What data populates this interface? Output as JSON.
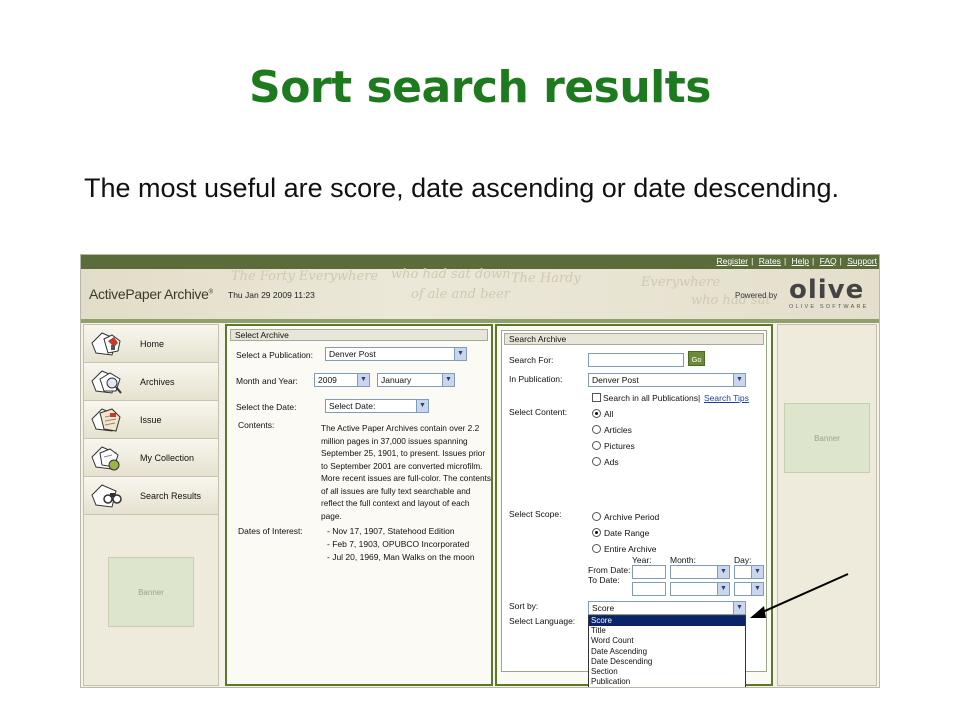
{
  "slide": {
    "title": "Sort search results",
    "body": "The most useful are score, date ascending or date descending."
  },
  "app": {
    "top_links": [
      "Register",
      "Rates",
      "Help",
      "FAQ",
      "Support"
    ],
    "brand": "ActivePaper Archive",
    "brand_mark": "®",
    "datetime": "Thu Jan 29 2009 11:23",
    "powered_by": "Powered by",
    "logo_word": "olive",
    "logo_sub": "OLIVE SOFTWARE",
    "watermark_lines": [
      "The Forty Everywhere",
      "who had sat down",
      "The Hardy",
      "of ale and beer",
      "Everywhere",
      "who had sat"
    ]
  },
  "nav": {
    "items": [
      {
        "label": "Home",
        "icon": "home-icon"
      },
      {
        "label": "Archives",
        "icon": "archives-search-icon"
      },
      {
        "label": "Issue",
        "icon": "issue-icon"
      },
      {
        "label": "My Collection",
        "icon": "collection-icon"
      },
      {
        "label": "Search Results",
        "icon": "binoculars-icon"
      }
    ],
    "banner": "Banner"
  },
  "select_archive": {
    "header": "Select Archive",
    "publication_label": "Select a Publication:",
    "publication_value": "Denver Post",
    "month_year_label": "Month and Year:",
    "year_value": "2009",
    "month_value": "January",
    "date_label": "Select the Date:",
    "date_value": "Select Date:",
    "contents_label": "Contents:",
    "contents_text": "The Active Paper Archives contain over 2.2 million pages in 37,000 issues spanning September 25, 1901, to present. Issues prior to September 2001 are converted microfilm. More recent issues are full-color. The contents of all issues are fully text searchable and reflect the full context and layout of each page.",
    "dates_label": "Dates of Interest:",
    "dates": [
      "- Nov 17, 1907, Statehood Edition",
      "- Feb 7, 1903, OPUBCO Incorporated",
      "- Jul 20, 1969, Man Walks on the moon"
    ]
  },
  "search_archive": {
    "header": "Search Archive",
    "search_for_label": "Search For:",
    "search_for_value": "",
    "go_label": "Go",
    "in_publication_label": "In Publication:",
    "in_publication_value": "Denver Post",
    "search_all_label": "Search in all Publications",
    "search_tips_label": "Search Tips",
    "select_content_label": "Select Content:",
    "content_options": [
      "All",
      "Articles",
      "Pictures",
      "Ads"
    ],
    "content_selected": "All",
    "select_scope_label": "Select Scope:",
    "scope_options": [
      "Archive Period",
      "Date Range",
      "Entire Archive"
    ],
    "scope_selected": "Date Range",
    "year_col": "Year:",
    "month_col": "Month:",
    "day_col": "Day:",
    "from_date_label": "From Date:",
    "to_date_label": "To Date:",
    "sort_by_label": "Sort by:",
    "sort_by_value": "Score",
    "select_language_label": "Select Language:",
    "sort_options": [
      "Score",
      "Title",
      "Word Count",
      "Date Ascending",
      "Date Descending",
      "Section",
      "Publication"
    ],
    "sort_highlighted": "Score"
  },
  "right_banner": "Banner",
  "colors": {
    "title_green": "#1e7a1e",
    "panel_border": "#5a7a2a",
    "highlight": "#0a246a",
    "link": "#1a3fa0"
  }
}
